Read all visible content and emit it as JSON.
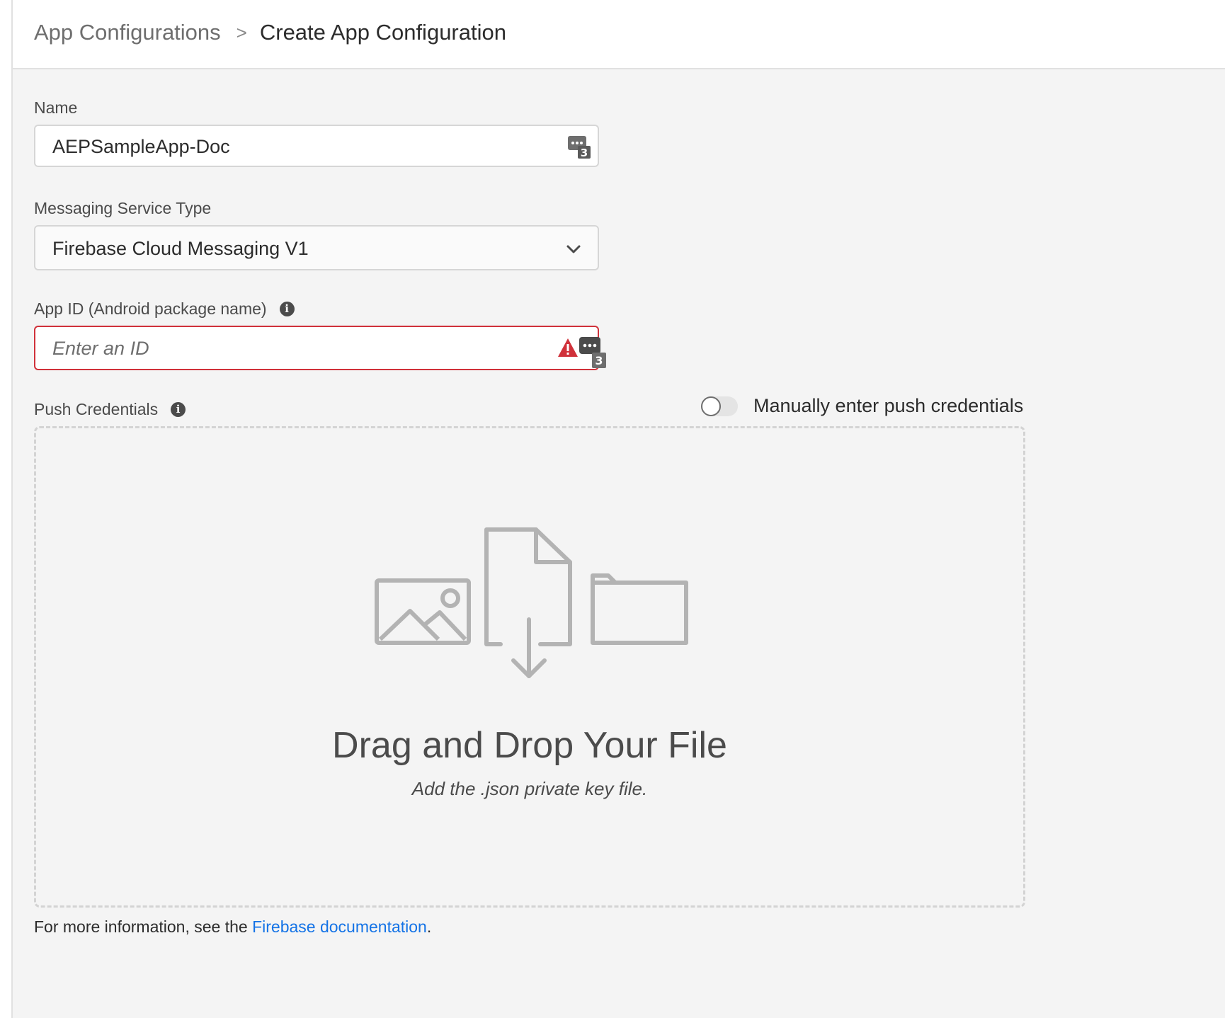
{
  "breadcrumb": {
    "parent": "App Configurations",
    "separator": ">",
    "current": "Create App Configuration"
  },
  "form": {
    "name": {
      "label": "Name",
      "value": "AEPSampleApp-Doc",
      "assist_badge": "3"
    },
    "messaging_service": {
      "label": "Messaging Service Type",
      "value": "Firebase Cloud Messaging V1"
    },
    "app_id": {
      "label": "App ID (Android package name)",
      "placeholder": "Enter an ID",
      "assist_badge": "3",
      "state": "error"
    },
    "push_credentials": {
      "label": "Push Credentials",
      "toggle_label": "Manually enter push credentials",
      "toggle_on": false
    }
  },
  "dropzone": {
    "title": "Drag and Drop Your File",
    "subtitle": "Add the .json private key file.",
    "icons": [
      "image-icon",
      "file-download-icon",
      "folder-icon"
    ]
  },
  "footnote": {
    "prefix": "For more information, see the ",
    "link": "Firebase documentation",
    "suffix": "."
  },
  "colors": {
    "error": "#d0313a",
    "link": "#1473e6",
    "background": "#f4f4f4"
  }
}
